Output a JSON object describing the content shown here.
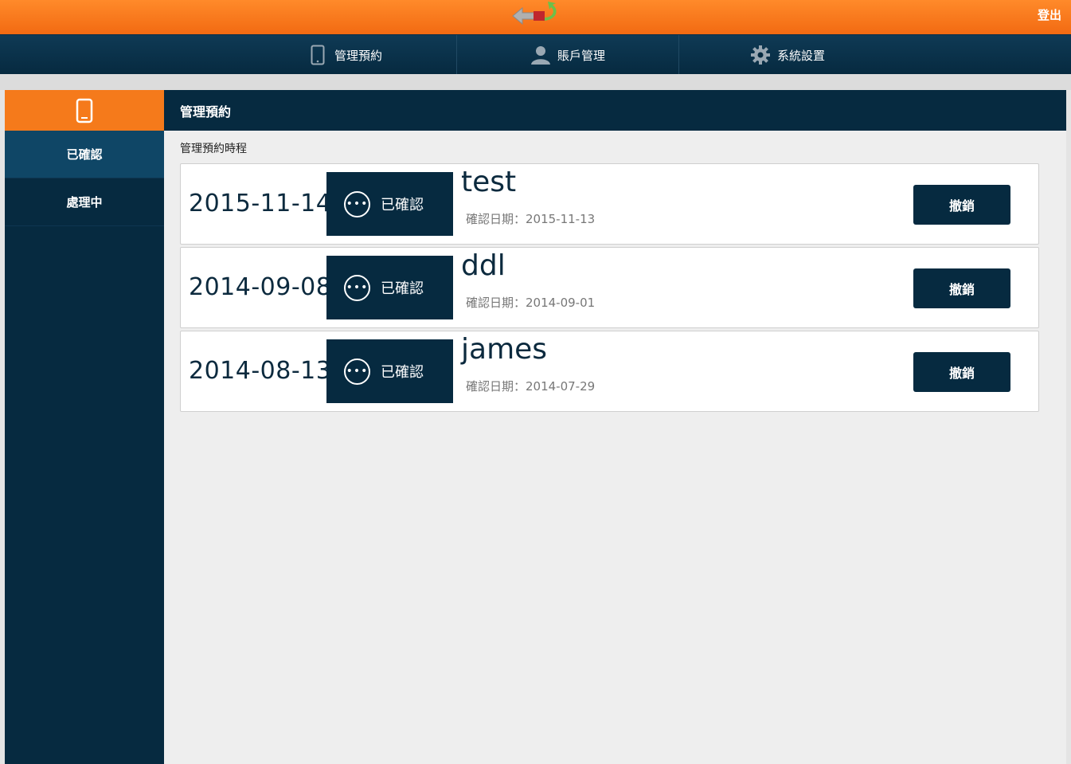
{
  "header": {
    "logout_label": "登出"
  },
  "nav": [
    {
      "label": "管理預約",
      "icon": "tablet-icon"
    },
    {
      "label": "賬戶管理",
      "icon": "user-icon"
    },
    {
      "label": "系統設置",
      "icon": "gear-icon"
    }
  ],
  "sidebar": {
    "icon": "tablet-icon",
    "items": [
      {
        "label": "已確認"
      },
      {
        "label": "處理中"
      }
    ]
  },
  "main": {
    "title": "管理預約",
    "subtitle": "管理預約時程",
    "bookings": [
      {
        "date": "2015-11-14",
        "status": "已確認",
        "name": "test",
        "confirm_label": "確認日期：2015-11-13",
        "cancel_label": "撤銷"
      },
      {
        "date": "2014-09-08",
        "status": "已確認",
        "name": "ddl",
        "confirm_label": "確認日期：2014-09-01",
        "cancel_label": "撤銷"
      },
      {
        "date": "2014-08-13",
        "status": "已確認",
        "name": "james",
        "confirm_label": "確認日期：2014-07-29",
        "cancel_label": "撤銷"
      }
    ]
  },
  "colors": {
    "accent": "#f57a1b",
    "navy": "#062a40",
    "active": "#0f4666"
  }
}
